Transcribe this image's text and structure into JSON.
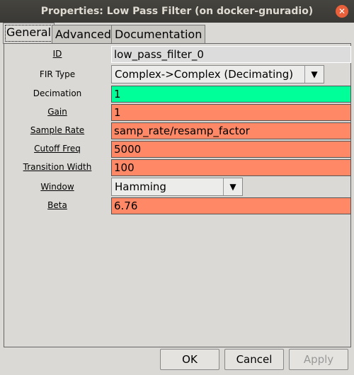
{
  "window": {
    "title": "Properties: Low Pass Filter (on docker-gnuradio)"
  },
  "tabs": [
    {
      "label": "General",
      "active": true
    },
    {
      "label": "Advanced"
    },
    {
      "label": "Documentation"
    }
  ],
  "params": [
    {
      "label": "ID",
      "value": "low_pass_filter_0",
      "color": "#dcdcdc"
    },
    {
      "label": "FIR Type",
      "value": "Complex->Complex (Decimating)"
    },
    {
      "label": "Decimation",
      "value": "1",
      "color": "#00ff99"
    },
    {
      "label": "Gain",
      "value": "1",
      "color": "#ff8866"
    },
    {
      "label": "Sample Rate",
      "value": "samp_rate/resamp_factor",
      "color": "#ff8866"
    },
    {
      "label": "Cutoff Freq",
      "value": "5000",
      "color": "#ff8866"
    },
    {
      "label": "Transition Width",
      "value": "100",
      "color": "#ff8866"
    },
    {
      "label": "Window",
      "value": "Hamming"
    },
    {
      "label": "Beta",
      "value": "6.76",
      "color": "#ff8866"
    }
  ],
  "buttons": {
    "ok": "OK",
    "cancel": "Cancel",
    "apply": "Apply"
  }
}
